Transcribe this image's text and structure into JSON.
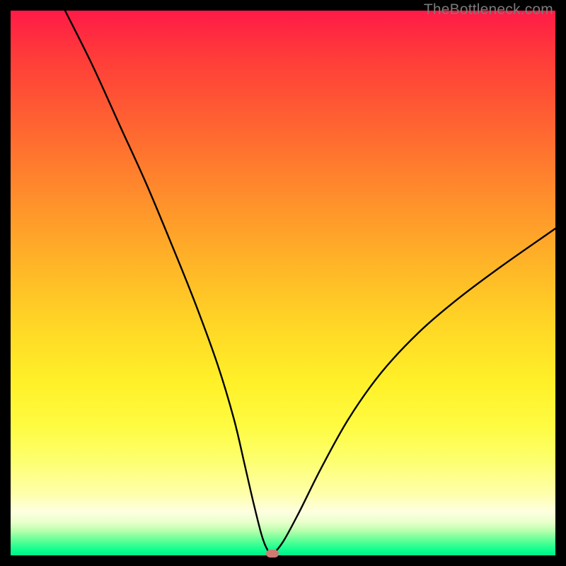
{
  "watermark": "TheBottleneck.com",
  "colors": {
    "frame": "#000000",
    "curve": "#000000",
    "minimum_marker": "#cf7b73",
    "gradient_top": "#ff1a48",
    "gradient_bottom": "#00ee8c"
  },
  "chart_data": {
    "type": "line",
    "title": "",
    "xlabel": "",
    "ylabel": "",
    "xlim": [
      0,
      100
    ],
    "ylim": [
      0,
      100
    ],
    "grid": false,
    "series": [
      {
        "name": "bottleneck-curve",
        "x": [
          10,
          15,
          20,
          25,
          30,
          34,
          38,
          41,
          43,
          44.5,
          46,
          47,
          48,
          50,
          53,
          57,
          62,
          68,
          75,
          82,
          90,
          100
        ],
        "values": [
          100,
          90,
          79,
          68,
          56,
          46,
          35,
          25,
          16.5,
          10,
          4,
          1.3,
          0.3,
          2.5,
          8,
          16,
          25,
          33.5,
          41,
          47,
          53,
          60
        ]
      }
    ],
    "minimum_point": {
      "x": 48,
      "y": 0.3
    },
    "background": "vertical heatmap gradient red→orange→yellow→green"
  }
}
